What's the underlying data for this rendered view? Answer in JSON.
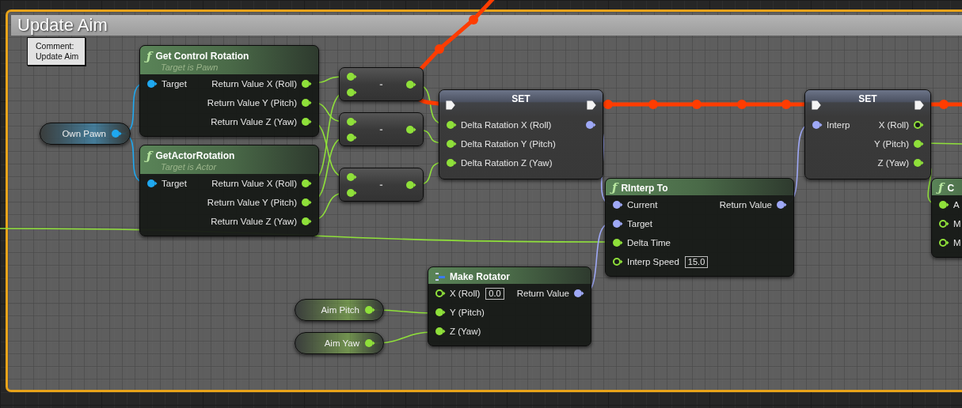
{
  "comment": {
    "title": "Update Aim",
    "tooltip": "Comment:\nUpdate Aim"
  },
  "nodes": [
    {
      "kind": "function",
      "icon": "ƒ",
      "title": "Get Control Rotation",
      "subtitle": "Target is Pawn",
      "inputs": [
        {
          "label": "Target",
          "color": "#1fa8f0",
          "connected": true
        }
      ],
      "outputs": [
        {
          "label": "Return Value X (Roll)",
          "color": "#8fe03a",
          "connected": true
        },
        {
          "label": "Return Value Y (Pitch)",
          "color": "#8fe03a",
          "connected": true
        },
        {
          "label": "Return Value Z (Yaw)",
          "color": "#8fe03a",
          "connected": true
        }
      ]
    },
    {
      "kind": "function",
      "icon": "ƒ",
      "title": "GetActorRotation",
      "subtitle": "Target is Actor",
      "inputs": [
        {
          "label": "Target",
          "color": "#1fa8f0",
          "connected": true
        }
      ],
      "outputs": [
        {
          "label": "Return Value X (Roll)",
          "color": "#8fe03a",
          "connected": true
        },
        {
          "label": "Return Value Y (Pitch)",
          "color": "#8fe03a",
          "connected": true
        },
        {
          "label": "Return Value Z (Yaw)",
          "color": "#8fe03a",
          "connected": true
        }
      ]
    },
    {
      "kind": "variable",
      "title": "Own Pawn",
      "outputs": [
        {
          "color": "#1fa8f0",
          "connected": true
        }
      ]
    },
    {
      "kind": "operator",
      "title": "-",
      "inputs": [
        {
          "color": "#8fe03a",
          "connected": true
        },
        {
          "color": "#8fe03a",
          "connected": true
        }
      ],
      "outputs": [
        {
          "color": "#8fe03a",
          "connected": true
        }
      ]
    },
    {
      "kind": "operator",
      "title": "-",
      "inputs": [
        {
          "color": "#8fe03a",
          "connected": true
        },
        {
          "color": "#8fe03a",
          "connected": true
        }
      ],
      "outputs": [
        {
          "color": "#8fe03a",
          "connected": true
        }
      ]
    },
    {
      "kind": "operator",
      "title": "-",
      "inputs": [
        {
          "color": "#8fe03a",
          "connected": true
        },
        {
          "color": "#8fe03a",
          "connected": true
        }
      ],
      "outputs": [
        {
          "color": "#8fe03a",
          "connected": true
        }
      ]
    },
    {
      "kind": "set",
      "title": "SET",
      "exec_in": {
        "connected": true
      },
      "exec_out": {
        "connected": true
      },
      "inputs": [
        {
          "label": "Delta Ratation X (Roll)",
          "color": "#8fe03a",
          "connected": true
        },
        {
          "label": "Delta Ratation Y (Pitch)",
          "color": "#8fe03a",
          "connected": true
        },
        {
          "label": "Delta Ratation Z (Yaw)",
          "color": "#8fe03a",
          "connected": true
        }
      ],
      "outputs": [
        {
          "color": "#9ea8f6",
          "connected": true
        }
      ]
    },
    {
      "kind": "set",
      "title": "SET",
      "exec_in": {
        "connected": true
      },
      "exec_out": {
        "connected": true
      },
      "inputs": [
        {
          "label": "Interp",
          "color": "#9ea8f6",
          "connected": true
        }
      ],
      "outputs": [
        {
          "label": "X (Roll)",
          "color": "#8fe03a",
          "connected": false
        },
        {
          "label": "Y (Pitch)",
          "color": "#8fe03a",
          "connected": true
        },
        {
          "label": "Z (Yaw)",
          "color": "#8fe03a",
          "connected": true
        }
      ]
    },
    {
      "kind": "function",
      "icon": "ƒ",
      "title": "RInterp To",
      "inputs": [
        {
          "label": "Current",
          "color": "#9ea8f6",
          "connected": true
        },
        {
          "label": "Target",
          "color": "#9ea8f6",
          "connected": true
        },
        {
          "label": "Delta Time",
          "color": "#8fe03a",
          "connected": true
        },
        {
          "label": "Interp Speed",
          "color": "#8fe03a",
          "connected": false,
          "default": "15.0"
        }
      ],
      "outputs": [
        {
          "label": "Return Value",
          "color": "#9ea8f6",
          "connected": true
        }
      ]
    },
    {
      "kind": "struct",
      "title": "Make Rotator",
      "inputs": [
        {
          "label": "X (Roll)",
          "color": "#8fe03a",
          "connected": false,
          "default": "0.0"
        },
        {
          "label": "Y (Pitch)",
          "color": "#8fe03a",
          "connected": true
        },
        {
          "label": "Z (Yaw)",
          "color": "#8fe03a",
          "connected": true
        }
      ],
      "outputs": [
        {
          "label": "Return Value",
          "color": "#9ea8f6",
          "connected": true
        }
      ]
    },
    {
      "kind": "variable",
      "title": "Aim Pitch",
      "outputs": [
        {
          "color": "#8fe03a",
          "connected": true
        }
      ]
    },
    {
      "kind": "variable",
      "title": "Aim Yaw",
      "outputs": [
        {
          "color": "#8fe03a",
          "connected": true
        }
      ]
    },
    {
      "kind": "function",
      "icon": "ƒ",
      "title": "C",
      "inputs": [
        {
          "label": "A",
          "color": "#8fe03a",
          "connected": true
        },
        {
          "label": "M",
          "color": "#8fe03a",
          "connected": false
        },
        {
          "label": "M",
          "color": "#8fe03a",
          "connected": false
        }
      ]
    }
  ]
}
